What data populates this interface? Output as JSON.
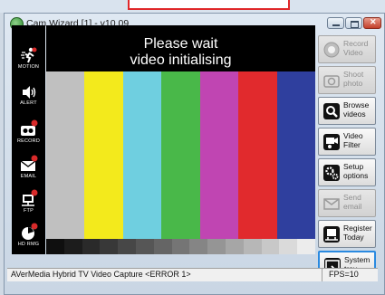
{
  "window": {
    "title": "Cam Wizard [1] - v10.09"
  },
  "video": {
    "message_line1": "Please wait",
    "message_line2": "video initialising",
    "color_bars": [
      "#c0c0c0",
      "#f3ea1c",
      "#6fcfe0",
      "#49b849",
      "#c045b2",
      "#e12a2d",
      "#2f3f9e"
    ],
    "gray_steps": [
      "#0f0f0f",
      "#1c1c1c",
      "#2a2a2a",
      "#383838",
      "#474747",
      "#565656",
      "#656565",
      "#757575",
      "#858585",
      "#959595",
      "#a6a6a6",
      "#b7b7b7",
      "#c8c8c8",
      "#dadada",
      "#ececec"
    ]
  },
  "sidebar": {
    "items": [
      {
        "label": "MOTION",
        "icon": "motion-icon"
      },
      {
        "label": "ALERT",
        "icon": "speaker-icon"
      },
      {
        "label": "RECORD",
        "icon": "record-icon"
      },
      {
        "label": "EMAIL",
        "icon": "email-icon"
      },
      {
        "label": "FTP",
        "icon": "ftp-icon"
      },
      {
        "label": "HD RMG",
        "icon": "disk-icon"
      }
    ]
  },
  "buttons": {
    "record_video": {
      "line1": "Record",
      "line2": "Video",
      "icon": "record-icon"
    },
    "shoot_photo": {
      "line1": "Shoot",
      "line2": "photo",
      "icon": "camera-icon"
    },
    "browse_videos": {
      "line1": "Browse",
      "line2": "videos",
      "icon": "browse-icon"
    },
    "video_filter": {
      "line1": "Video",
      "line2": "Filter",
      "icon": "filter-icon"
    },
    "setup_options": {
      "line1": "Setup",
      "line2": "options",
      "icon": "gear-icon"
    },
    "send_email": {
      "line1": "Send",
      "line2": "email",
      "icon": "email-icon"
    },
    "register_today": {
      "line1": "Register",
      "line2": "Today",
      "icon": "register-icon"
    },
    "system_tray": {
      "line1": "System",
      "line2": "tray",
      "icon": "tray-icon"
    }
  },
  "status": {
    "device": "AVerMedia Hybrid TV Video Capture <ERROR 1>",
    "fps": "FPS=10"
  }
}
